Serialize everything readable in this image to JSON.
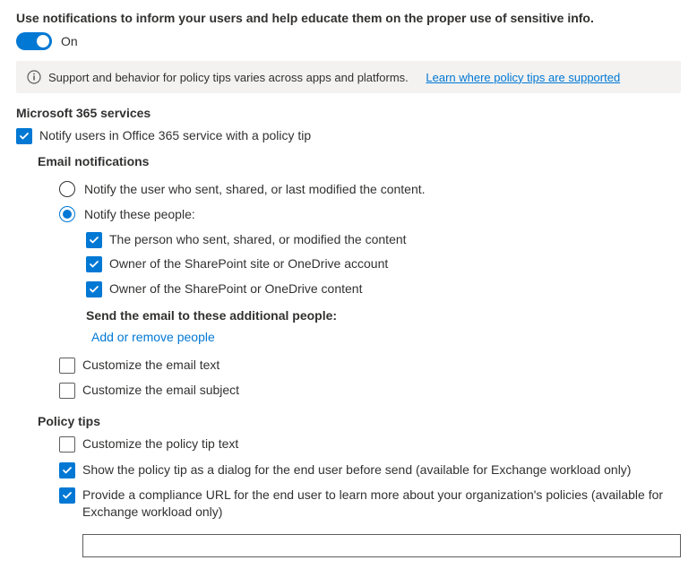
{
  "header": {
    "title": "Use notifications to inform your users and help educate them on the proper use of sensitive info.",
    "toggle_state": "On"
  },
  "info_banner": {
    "text": "Support and behavior for policy tips varies across apps and platforms.",
    "link_text": "Learn where policy tips are supported"
  },
  "services": {
    "heading": "Microsoft 365 services",
    "notify_office365": "Notify users in Office 365 service with a policy tip"
  },
  "email_notifications": {
    "heading": "Email notifications",
    "radio_notify_user": "Notify the user who sent, shared, or last modified the content.",
    "radio_notify_people": "Notify these people:",
    "cb_person_sent": "The person who sent, shared, or modified the content",
    "cb_owner_site": "Owner of the SharePoint site or OneDrive account",
    "cb_owner_content": "Owner of the SharePoint or OneDrive content",
    "additional_heading": "Send the email to these additional people:",
    "add_people_link": "Add or remove people",
    "cb_custom_text": "Customize the email text",
    "cb_custom_subject": "Customize the email subject"
  },
  "policy_tips": {
    "heading": "Policy tips",
    "cb_custom_tip_text": "Customize the policy tip text",
    "cb_dialog": "Show the policy tip as a dialog for the end user before send (available for Exchange workload only)",
    "cb_compliance_url": "Provide a compliance URL for the end user to learn more about your organization's policies (available for Exchange workload only)"
  }
}
